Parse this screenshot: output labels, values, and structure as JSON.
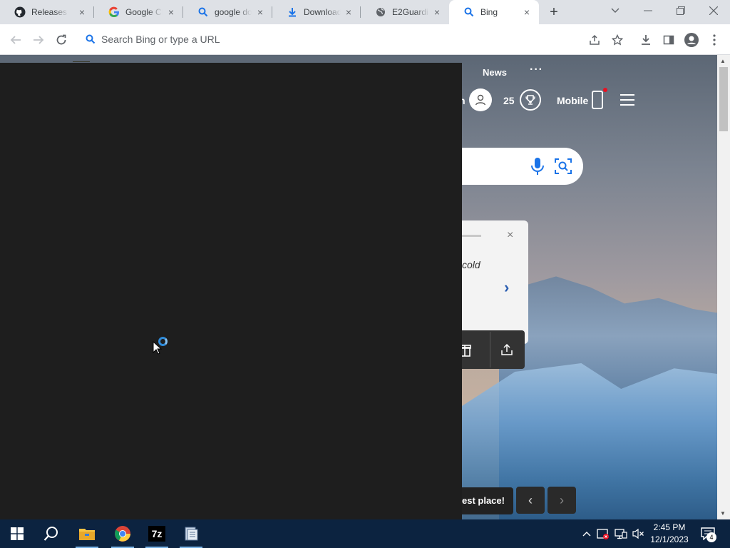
{
  "browser": {
    "tabs": [
      {
        "title": "Releases ·",
        "icon": "github-icon",
        "active": false
      },
      {
        "title": "Google Ch",
        "icon": "google-icon",
        "active": false
      },
      {
        "title": "google do",
        "icon": "search-icon",
        "active": false
      },
      {
        "title": "Download",
        "icon": "download-icon",
        "active": false
      },
      {
        "title": "E2Guardia",
        "icon": "globe-icon",
        "active": false
      },
      {
        "title": "Bing",
        "icon": "search-icon",
        "active": true
      }
    ],
    "omnibox_placeholder": "Search Bing or type a URL"
  },
  "bing": {
    "nav_news": "News",
    "more_menu": "···",
    "signin_fragment": "n",
    "rewards_points": "25",
    "mobile_label": "Mobile",
    "card_text": "cold",
    "caption_text": "est place!",
    "prev_glyph": "‹",
    "next_glyph": "›",
    "close_glyph": "×",
    "chevron_glyph": "›"
  },
  "taskbar": {
    "apps": [
      "start",
      "search",
      "file-explorer",
      "chrome",
      "7zip",
      "notepad-app"
    ],
    "sevenzip_label": "7z",
    "time": "2:45 PM",
    "date": "12/1/2023",
    "notification_count": "4"
  },
  "colors": {
    "taskbar": "#0c2340",
    "overlay": "#1e1e1e",
    "spinner": "#2e8ad8",
    "bing_dark_ui": "#333333",
    "card_chevron": "#2a5db0"
  }
}
